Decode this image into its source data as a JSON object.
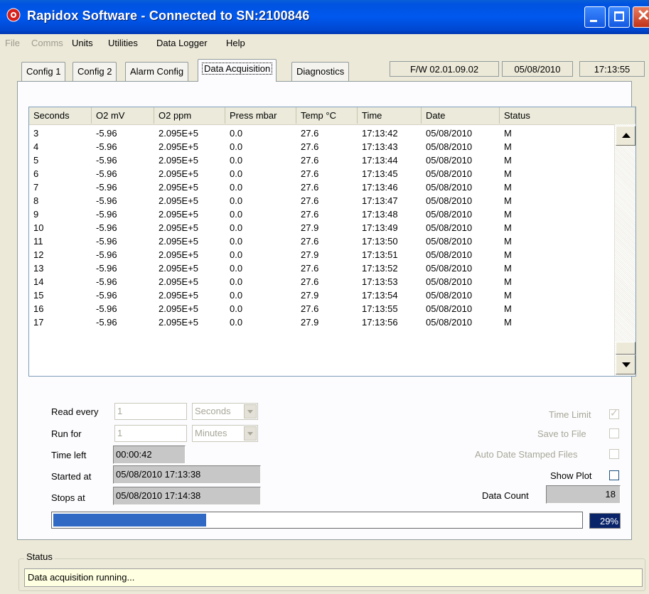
{
  "window": {
    "title": "Rapidox Software - Connected to SN:2100846"
  },
  "menu": [
    {
      "label": "File",
      "enabled": false
    },
    {
      "label": "Comms",
      "enabled": false
    },
    {
      "label": "Units",
      "enabled": true
    },
    {
      "label": "Utilities",
      "enabled": true
    },
    {
      "label": "Data Logger",
      "enabled": true
    },
    {
      "label": "Help",
      "enabled": true
    }
  ],
  "tabs": [
    "Config 1",
    "Config 2",
    "Alarm Config",
    "Data Acquisition",
    "Diagnostics"
  ],
  "active_tab": "Data Acquisition",
  "info": {
    "firmware": "F/W 02.01.09.02",
    "date": "05/08/2010",
    "time": "17:13:55"
  },
  "table": {
    "columns": [
      "Seconds",
      "O2 mV",
      "O2 ppm",
      "Press mbar",
      "Temp °C",
      "Time",
      "Date",
      "Status"
    ],
    "rows": [
      [
        "3",
        "-5.96",
        "2.095E+5",
        "0.0",
        "27.6",
        "17:13:42",
        "05/08/2010",
        "M"
      ],
      [
        "4",
        "-5.96",
        "2.095E+5",
        "0.0",
        "27.6",
        "17:13:43",
        "05/08/2010",
        "M"
      ],
      [
        "5",
        "-5.96",
        "2.095E+5",
        "0.0",
        "27.6",
        "17:13:44",
        "05/08/2010",
        "M"
      ],
      [
        "6",
        "-5.96",
        "2.095E+5",
        "0.0",
        "27.6",
        "17:13:45",
        "05/08/2010",
        "M"
      ],
      [
        "7",
        "-5.96",
        "2.095E+5",
        "0.0",
        "27.6",
        "17:13:46",
        "05/08/2010",
        "M"
      ],
      [
        "8",
        "-5.96",
        "2.095E+5",
        "0.0",
        "27.6",
        "17:13:47",
        "05/08/2010",
        "M"
      ],
      [
        "9",
        "-5.96",
        "2.095E+5",
        "0.0",
        "27.6",
        "17:13:48",
        "05/08/2010",
        "M"
      ],
      [
        "10",
        "-5.96",
        "2.095E+5",
        "0.0",
        "27.9",
        "17:13:49",
        "05/08/2010",
        "M"
      ],
      [
        "11",
        "-5.96",
        "2.095E+5",
        "0.0",
        "27.6",
        "17:13:50",
        "05/08/2010",
        "M"
      ],
      [
        "12",
        "-5.96",
        "2.095E+5",
        "0.0",
        "27.9",
        "17:13:51",
        "05/08/2010",
        "M"
      ],
      [
        "13",
        "-5.96",
        "2.095E+5",
        "0.0",
        "27.6",
        "17:13:52",
        "05/08/2010",
        "M"
      ],
      [
        "14",
        "-5.96",
        "2.095E+5",
        "0.0",
        "27.6",
        "17:13:53",
        "05/08/2010",
        "M"
      ],
      [
        "15",
        "-5.96",
        "2.095E+5",
        "0.0",
        "27.9",
        "17:13:54",
        "05/08/2010",
        "M"
      ],
      [
        "16",
        "-5.96",
        "2.095E+5",
        "0.0",
        "27.6",
        "17:13:55",
        "05/08/2010",
        "M"
      ],
      [
        "17",
        "-5.96",
        "2.095E+5",
        "0.0",
        "27.9",
        "17:13:56",
        "05/08/2010",
        "M"
      ]
    ]
  },
  "controls": {
    "read_every_label": "Read every",
    "read_every_value": "1",
    "read_every_unit": "Seconds",
    "run_for_label": "Run for",
    "run_for_value": "1",
    "run_for_unit": "Minutes",
    "time_left_label": "Time left",
    "time_left_value": "00:00:42",
    "started_at_label": "Started at",
    "started_at_value": "05/08/2010 17:13:38",
    "stops_at_label": "Stops at",
    "stops_at_value": "05/08/2010 17:14:38",
    "time_limit_label": "Time Limit",
    "time_limit_checked": true,
    "save_to_file_label": "Save to File",
    "save_to_file_checked": false,
    "auto_date_label": "Auto Date Stamped Files",
    "auto_date_checked": false,
    "show_plot_label": "Show Plot",
    "show_plot_checked": false,
    "data_count_label": "Data Count",
    "data_count_value": "18"
  },
  "progress": {
    "fraction": 0.29,
    "label": "29%"
  },
  "status": {
    "legend": "Status",
    "text": "Data acquisition running..."
  },
  "colors": {
    "titlebar": "#0058ee",
    "progress": "#316ac5",
    "status_bg": "#ffffe1"
  }
}
